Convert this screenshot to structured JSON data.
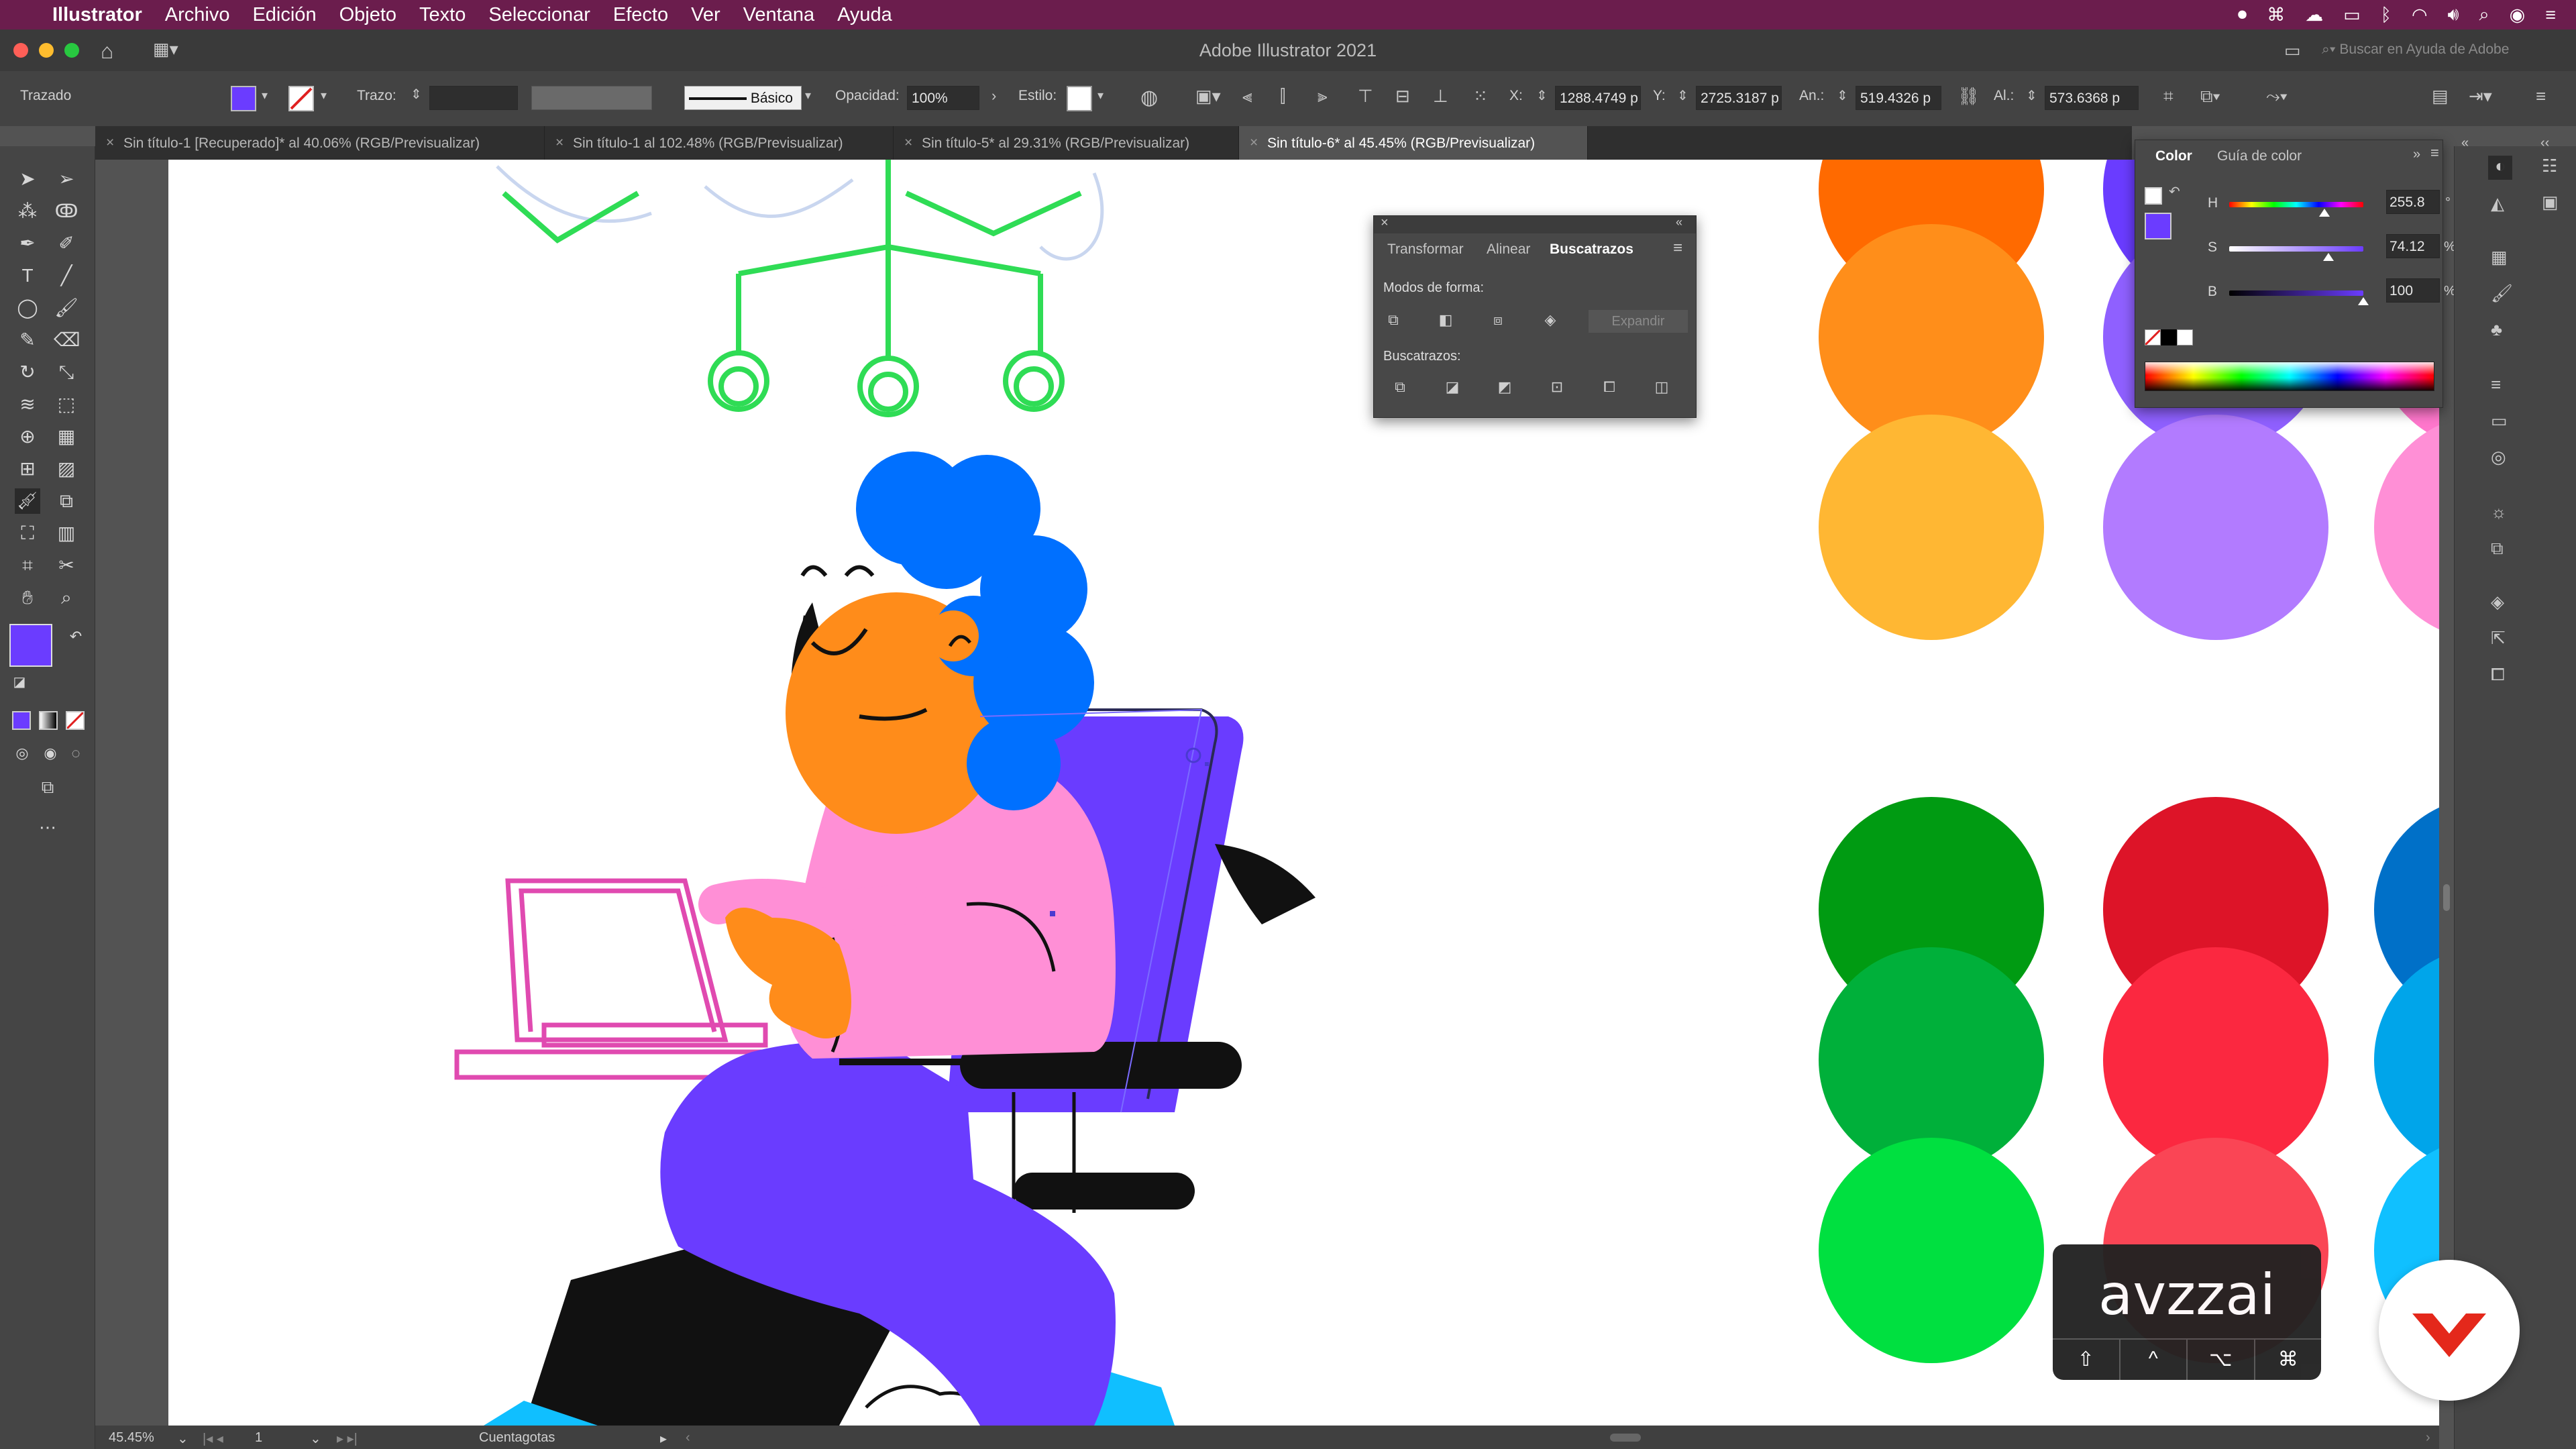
{
  "menubar": {
    "app": "Illustrator",
    "items": [
      "Archivo",
      "Edición",
      "Objeto",
      "Texto",
      "Seleccionar",
      "Efecto",
      "Ver",
      "Ventana",
      "Ayuda"
    ]
  },
  "window": {
    "title": "Adobe Illustrator 2021"
  },
  "control": {
    "selection_type": "Trazado",
    "stroke_label": "Trazo:",
    "brush_label": "Básico",
    "opacity_label": "Opacidad:",
    "opacity_value": "100%",
    "style_label": "Estilo:",
    "x_label": "X:",
    "x_value": "1288.4749 p",
    "y_label": "Y:",
    "y_value": "2725.3187 p",
    "w_label": "An.:",
    "w_value": "519.4326 p",
    "h_label": "Al.:",
    "h_value": "573.6368 p",
    "search_placeholder": "Buscar en Ayuda de Adobe",
    "fill_color": "#6b3cff"
  },
  "tabs": [
    {
      "label": "Sin título-1 [Recuperado]* al 40.06% (RGB/Previsualizar)",
      "active": false
    },
    {
      "label": "Sin título-1 al 102.48% (RGB/Previsualizar)",
      "active": false
    },
    {
      "label": "Sin título-5* al 29.31% (RGB/Previsualizar)",
      "active": false
    },
    {
      "label": "Sin título-6* al 45.45% (RGB/Previsualizar)",
      "active": true
    }
  ],
  "pathfinder": {
    "tabs": [
      "Transformar",
      "Alinear",
      "Buscatrazos"
    ],
    "active_tab": "Buscatrazos",
    "shape_modes_label": "Modos de forma:",
    "expand_label": "Expandir",
    "pathfinders_label": "Buscatrazos:"
  },
  "color_panel": {
    "tabs": [
      "Color",
      "Guía de color"
    ],
    "active_tab": "Color",
    "channels": [
      {
        "label": "H",
        "value": "255.8",
        "unit": "°",
        "level": 0.71
      },
      {
        "label": "S",
        "value": "74.12",
        "unit": "%",
        "level": 0.74
      },
      {
        "label": "B",
        "value": "100",
        "unit": "%",
        "level": 1.0
      }
    ]
  },
  "status": {
    "zoom": "45.45%",
    "artboard": "1",
    "tool": "Cuentagotas"
  },
  "key_overlay": {
    "text": "avzzai",
    "keys": [
      "⇧",
      "^",
      "⌥",
      "⌘"
    ]
  },
  "palette": {
    "columns": [
      [
        "#ff6a00",
        "#ff8e1a",
        "#ffb733"
      ],
      [
        "#6a3cff",
        "#8f60ff",
        "#b27bff"
      ],
      [
        "#ff5fbf",
        "#ff77cc",
        "#ff8fd6"
      ]
    ],
    "bottom_columns": [
      [
        "#009b12",
        "#00b03a",
        "#00e040"
      ],
      [
        "#dd1428",
        "#fb2840",
        "#fa4555"
      ],
      [
        "#0070c8",
        "#00a5ea",
        "#10c0ff"
      ]
    ]
  }
}
